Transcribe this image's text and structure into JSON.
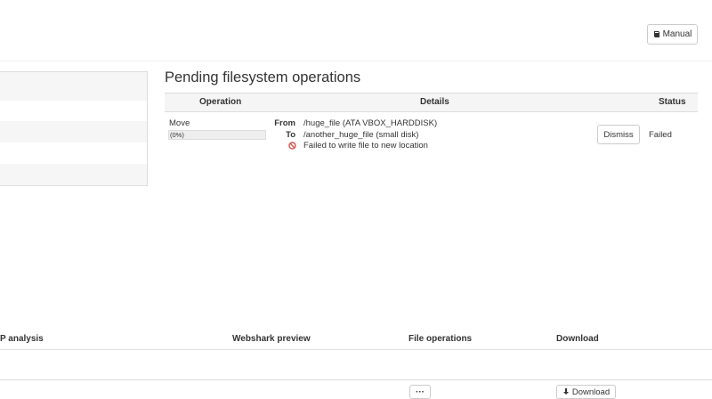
{
  "toolbar": {
    "manual_label": "Manual",
    "manual_icon": "book-icon"
  },
  "pending": {
    "title": "Pending filesystem operations",
    "columns": {
      "operation": "Operation",
      "details": "Details",
      "status": "Status"
    },
    "rows": [
      {
        "operation": "Move",
        "progress_label": "(0%)",
        "progress": 0,
        "from_label": "From",
        "from_value": "/huge_file (ATA VBOX_HARDDISK)",
        "to_label": "To",
        "to_value": "/another_huge_file (small disk)",
        "error": "Failed to write file to new location",
        "error_icon": "ban-icon",
        "error_color": "#d9534f",
        "dismiss_label": "Dismiss",
        "status": "Failed"
      }
    ]
  },
  "files_table": {
    "columns": {
      "analysis": "P analysis",
      "webshark": "Webshark preview",
      "file_ops": "File operations",
      "download": "Download"
    },
    "row": {
      "more_label": "···",
      "download_label": "Download",
      "download_icon": "download-icon"
    }
  }
}
